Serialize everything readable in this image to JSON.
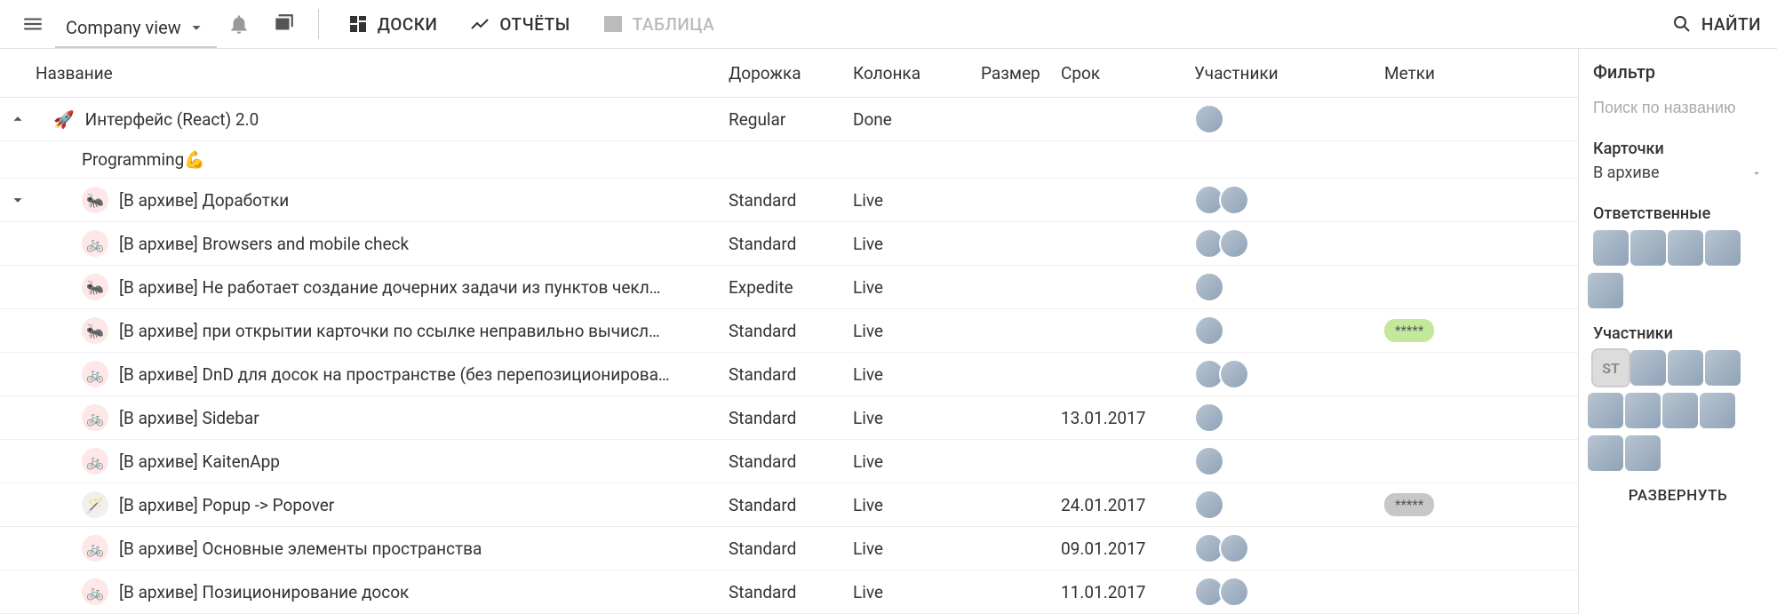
{
  "header": {
    "view_label": "Company view",
    "nav": {
      "boards": "ДОСКИ",
      "reports": "ОТЧЁТЫ",
      "table": "ТАБЛИЦА"
    },
    "search": "НАЙТИ"
  },
  "columns": {
    "title": "Название",
    "lane": "Дорожка",
    "column": "Колонка",
    "size": "Размер",
    "due": "Срок",
    "members": "Участники",
    "tags": "Метки"
  },
  "parent": {
    "icon": "🚀",
    "title": "Интерфейс (React) 2.0",
    "lane": "Regular",
    "column": "Done"
  },
  "group_label": "Programming💪",
  "rows": [
    {
      "icon": "bug",
      "title": "[В архиве] Доработки",
      "lane": "Standard",
      "column": "Live",
      "due": "",
      "members": 2,
      "tag": null
    },
    {
      "icon": "bike",
      "title": "[В архиве] Browsers and mobile check",
      "lane": "Standard",
      "column": "Live",
      "due": "",
      "members": 2,
      "tag": null
    },
    {
      "icon": "bug",
      "title": "[В архиве] Не работает создание дочерних задачи из пунктов чекл…",
      "lane": "Expedite",
      "column": "Live",
      "due": "",
      "members": 1,
      "tag": null
    },
    {
      "icon": "bug",
      "title": "[В архиве] при открытии карточки по ссылке неправильно вычисл…",
      "lane": "Standard",
      "column": "Live",
      "due": "",
      "members": 1,
      "tag": {
        "text": "*****",
        "color": "green"
      }
    },
    {
      "icon": "bike",
      "title": "[В архиве] DnD для досок на пространстве (без перепозиционирова…",
      "lane": "Standard",
      "column": "Live",
      "due": "",
      "members": 2,
      "tag": null
    },
    {
      "icon": "bike",
      "title": "[В архиве] Sidebar",
      "lane": "Standard",
      "column": "Live",
      "due": "13.01.2017",
      "members": 1,
      "tag": null
    },
    {
      "icon": "bike",
      "title": "[В архиве] KaitenApp",
      "lane": "Standard",
      "column": "Live",
      "due": "",
      "members": 1,
      "tag": null
    },
    {
      "icon": "wand",
      "title": "[В архиве] Popup -> Popover",
      "lane": "Standard",
      "column": "Live",
      "due": "24.01.2017",
      "members": 1,
      "tag": {
        "text": "*****",
        "color": "grey"
      }
    },
    {
      "icon": "bike",
      "title": "[В архиве] Основные элементы пространства",
      "lane": "Standard",
      "column": "Live",
      "due": "09.01.2017",
      "members": 2,
      "tag": null
    },
    {
      "icon": "bike",
      "title": "[В архиве] Позиционирование досок",
      "lane": "Standard",
      "column": "Live",
      "due": "11.01.2017",
      "members": 2,
      "tag": null
    }
  ],
  "filter": {
    "title": "Фильтр",
    "search_placeholder": "Поиск по названию",
    "cards_label": "Карточки",
    "cards_value": "В архиве",
    "owners_label": "Ответственные",
    "members_label": "Участники",
    "expand": "РАЗВЕРНУТЬ",
    "owners_count": 5,
    "members_count": 10,
    "member_initials": "ST"
  }
}
